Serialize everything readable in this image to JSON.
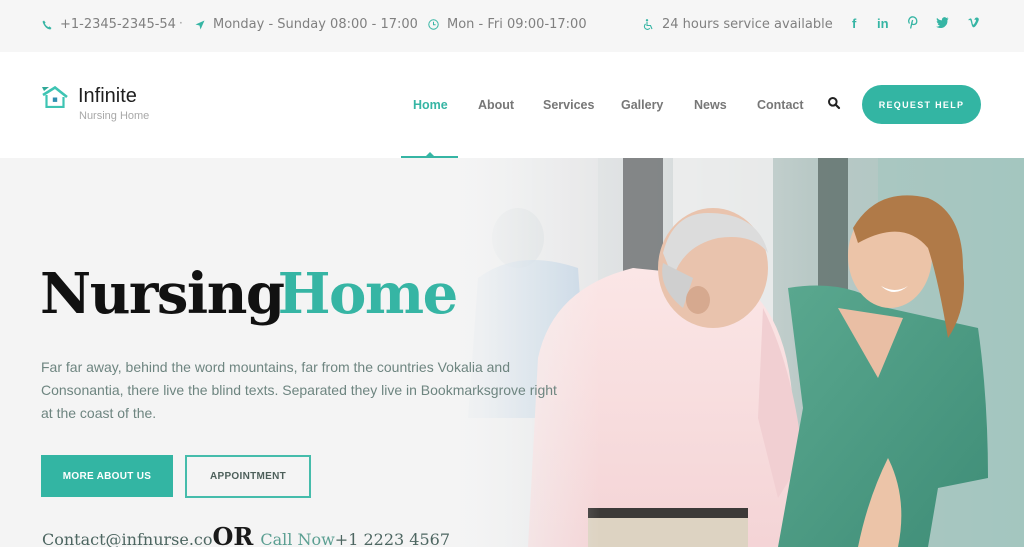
{
  "topbar": {
    "phone": "+1-2345-2345-54",
    "days": "Monday - Sunday 08:00 - 17:00",
    "hours": "Mon - Fri 09:00-17:00",
    "service": "24 hours service available",
    "separator": "·",
    "social": [
      {
        "name": "facebook",
        "glyph": "f"
      },
      {
        "name": "linkedin",
        "glyph": "in"
      },
      {
        "name": "pinterest",
        "glyph": "℗"
      },
      {
        "name": "twitter",
        "glyph": "🐦"
      },
      {
        "name": "vimeo",
        "glyph": "v"
      }
    ]
  },
  "header": {
    "logo_title": "Infinite",
    "logo_subtitle": "Nursing Home",
    "nav": [
      "Home",
      "About",
      "Services",
      "Gallery",
      "News",
      "Contact"
    ],
    "active_nav": "Home",
    "cta": "REQUEST HELP"
  },
  "hero": {
    "title_part1": "Nursing",
    "title_part2": "Home",
    "description": "Far far away, behind the word mountains, far from the countries Vokalia and Consonantia, there live the blind texts. Separated they live in Bookmarksgrove right at the coast of the.",
    "btn_primary": "MORE ABOUT US",
    "btn_secondary": "APPOINTMENT",
    "contact_email": "Contact@infnurse.co",
    "or_text": "OR",
    "call_label": "Call Now",
    "call_number": "+1 2223 4567"
  },
  "colors": {
    "accent": "#36b5a4",
    "text_dark": "#111111",
    "text_muted": "#808080"
  }
}
